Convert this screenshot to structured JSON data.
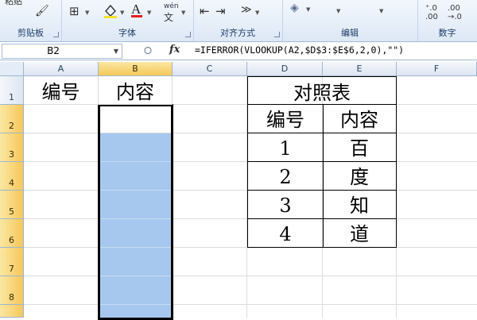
{
  "ribbon": {
    "groups": [
      {
        "label": "剪贴板"
      },
      {
        "label": "字体"
      },
      {
        "label": "对齐方式"
      },
      {
        "label": "编辑"
      },
      {
        "label": "数字"
      }
    ],
    "clipped_text": "粘贴",
    "wen_label": "wén",
    "wen_char": "文"
  },
  "formula_bar": {
    "name_box": "B2",
    "fx": "fx",
    "formula": "=IFERROR(VLOOKUP(A2,$D$3:$E$6,2,0),\"\")"
  },
  "columns": [
    "A",
    "B",
    "C",
    "D",
    "E",
    "F"
  ],
  "rows": [
    "1",
    "2",
    "3",
    "4",
    "5",
    "6",
    "7",
    "8"
  ],
  "cells": {
    "A1": "编号",
    "B1": "内容",
    "D1": "对照表",
    "D2": "编号",
    "E2": "内容",
    "D3": "1",
    "E3": "百",
    "D4": "2",
    "E4": "度",
    "D5": "3",
    "E5": "知",
    "D6": "4",
    "E6": "道"
  },
  "colors": {
    "selection_fill": "#a7c8ee",
    "header_selected": "#f5c75a",
    "ribbon_bg": "#dde8f6"
  }
}
